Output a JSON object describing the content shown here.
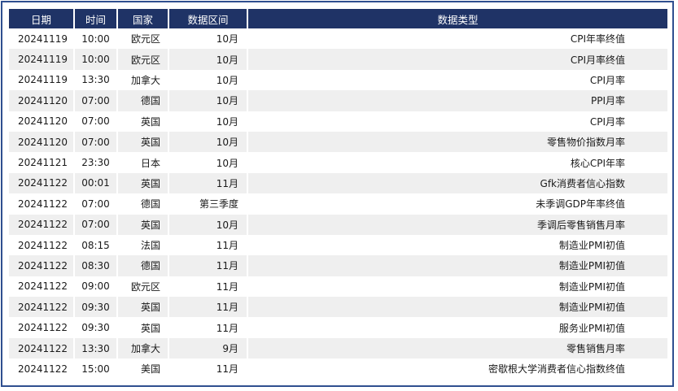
{
  "headers": [
    "日期",
    "时间",
    "国家",
    "数据区间",
    "数据类型"
  ],
  "rows": [
    [
      "20241119",
      "10:00",
      "欧元区",
      "10月",
      "CPI年率终值"
    ],
    [
      "20241119",
      "10:00",
      "欧元区",
      "10月",
      "CPI月率终值"
    ],
    [
      "20241119",
      "13:30",
      "加拿大",
      "10月",
      "CPI月率"
    ],
    [
      "20241120",
      "07:00",
      "德国",
      "10月",
      "PPI月率"
    ],
    [
      "20241120",
      "07:00",
      "英国",
      "10月",
      "CPI月率"
    ],
    [
      "20241120",
      "07:00",
      "英国",
      "10月",
      "零售物价指数月率"
    ],
    [
      "20241121",
      "23:30",
      "日本",
      "10月",
      "核心CPI年率"
    ],
    [
      "20241122",
      "00:01",
      "英国",
      "11月",
      "Gfk消费者信心指数"
    ],
    [
      "20241122",
      "07:00",
      "德国",
      "第三季度",
      "未季调GDP年率终值"
    ],
    [
      "20241122",
      "07:00",
      "英国",
      "10月",
      "季调后零售销售月率"
    ],
    [
      "20241122",
      "08:15",
      "法国",
      "11月",
      "制造业PMI初值"
    ],
    [
      "20241122",
      "08:30",
      "德国",
      "11月",
      "制造业PMI初值"
    ],
    [
      "20241122",
      "09:00",
      "欧元区",
      "11月",
      "制造业PMI初值"
    ],
    [
      "20241122",
      "09:30",
      "英国",
      "11月",
      "制造业PMI初值"
    ],
    [
      "20241122",
      "09:30",
      "英国",
      "11月",
      "服务业PMI初值"
    ],
    [
      "20241122",
      "13:30",
      "加拿大",
      "9月",
      "零售销售月率"
    ],
    [
      "20241122",
      "15:00",
      "美国",
      "11月",
      "密歇根大学消费者信心指数终值"
    ]
  ],
  "colors": {
    "header_bg": "#1f3366",
    "header_text": "#ffffff",
    "stripe": "#efefef",
    "frame_border": "#2f4f8f"
  }
}
